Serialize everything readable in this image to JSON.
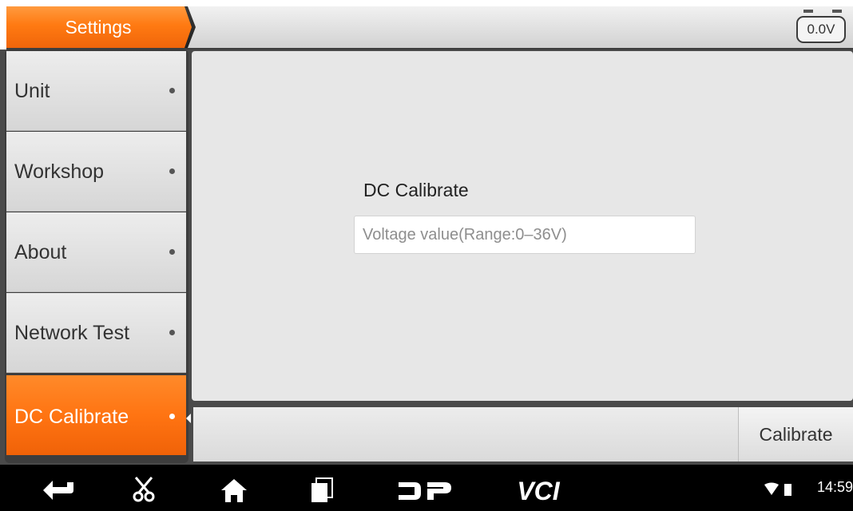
{
  "header": {
    "title": "Settings",
    "battery_voltage": "0.0V"
  },
  "sidebar": {
    "items": [
      {
        "label": "Unit",
        "active": false
      },
      {
        "label": "Workshop",
        "active": false
      },
      {
        "label": "About",
        "active": false
      },
      {
        "label": "Network Test",
        "active": false
      },
      {
        "label": "DC Calibrate",
        "active": true
      }
    ]
  },
  "main": {
    "section_title": "DC Calibrate",
    "voltage_input": {
      "value": "",
      "placeholder": "Voltage value(Range:0–36V)"
    }
  },
  "actions": {
    "calibrate_label": "Calibrate"
  },
  "navbar": {
    "icons": [
      "back-icon",
      "scissors-icon",
      "home-icon",
      "recent-apps-icon",
      "dp-logo-icon",
      "vci-logo-icon"
    ],
    "time": "14:59",
    "vci_label": "VCI",
    "dp_label": "DP"
  },
  "colors": {
    "accent": "#ff7a12",
    "panel": "#e7e7e7",
    "frame": "#3d3d3d"
  }
}
